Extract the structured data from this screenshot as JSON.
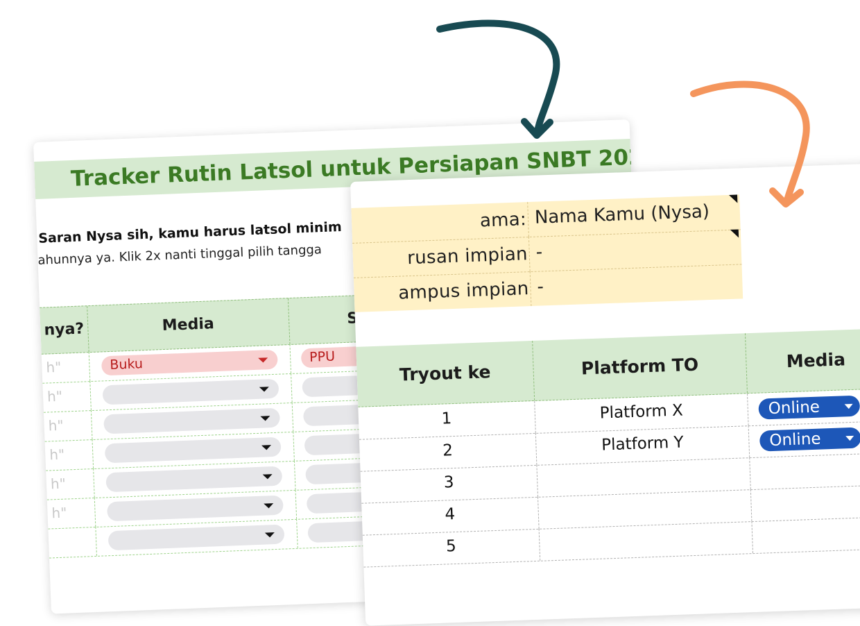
{
  "back_sheet": {
    "title": "Tracker Rutin Latsol untuk Persiapan SNBT 202",
    "note_line1": "Saran Nysa sih, kamu harus latsol minim",
    "note_line2": "ahunnya ya. Klik 2x nanti tinggal pilih tangga",
    "headers": [
      "nya?",
      "Media",
      "Su"
    ],
    "rows": [
      {
        "quote": "h\"",
        "media": "Buku",
        "media_highlight": true,
        "subject": "PPU"
      },
      {
        "quote": "h\"",
        "media": "",
        "media_highlight": false,
        "subject": ""
      },
      {
        "quote": "h\"",
        "media": "",
        "media_highlight": false,
        "subject": ""
      },
      {
        "quote": "h\"",
        "media": "",
        "media_highlight": false,
        "subject": ""
      },
      {
        "quote": "h\"",
        "media": "",
        "media_highlight": false,
        "subject": ""
      },
      {
        "quote": "h\"",
        "media": "",
        "media_highlight": false,
        "subject": ""
      },
      {
        "quote": "",
        "media": "",
        "media_highlight": false,
        "subject": ""
      }
    ]
  },
  "front_sheet": {
    "profile": [
      {
        "label": "ama:",
        "value": "Nama Kamu (Nysa)"
      },
      {
        "label": "rusan impian",
        "value": "-"
      },
      {
        "label": "ampus impian",
        "value": "-"
      }
    ],
    "headers": [
      "Tryout ke",
      "Platform TO",
      "Media"
    ],
    "rows": [
      {
        "no": "1",
        "platform": "Platform X",
        "media": "Online"
      },
      {
        "no": "2",
        "platform": "Platform Y",
        "media": "Online"
      },
      {
        "no": "3",
        "platform": "",
        "media": ""
      },
      {
        "no": "4",
        "platform": "",
        "media": ""
      },
      {
        "no": "5",
        "platform": "",
        "media": ""
      }
    ]
  },
  "colors": {
    "arrow_dark": "#184a52",
    "arrow_orange": "#f4955c",
    "header_green": "#d6ead0",
    "title_green": "#3b7a24",
    "profile_yellow": "#fff1c6",
    "pill_blue": "#1d57b8",
    "chip_red": "#f8cfcf"
  }
}
